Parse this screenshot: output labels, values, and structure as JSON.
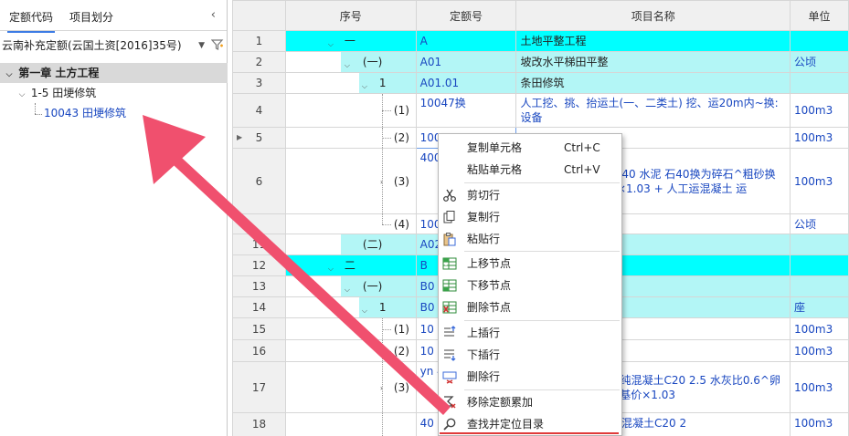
{
  "left_panel": {
    "tabs": [
      {
        "label": "定额代码"
      },
      {
        "label": "项目划分"
      }
    ],
    "collapse_glyph": "‹",
    "selector_value": "云南补充定额(云国土资[2016]35号)",
    "tree": {
      "chapter": "第一章 土方工程",
      "section": "1-5 田埂修筑",
      "item": "10043 田埂修筑"
    }
  },
  "grid": {
    "columns": [
      "序号",
      "定额号",
      "项目名称",
      "单位"
    ],
    "rows": [
      {
        "n": "1",
        "seq": "一",
        "code": "A",
        "name": "土地平整工程",
        "unit": ""
      },
      {
        "n": "2",
        "seq": "(一)",
        "code": "A01",
        "name": "坡改水平梯田平整",
        "unit": "公顷"
      },
      {
        "n": "3",
        "seq": "1",
        "code": "A01.01",
        "name": "条田修筑",
        "unit": ""
      },
      {
        "n": "4",
        "seq": "(1)",
        "code": "10047换",
        "name": "人工挖、挑、抬运土(一、二类土) 挖、运20m内~换:设备",
        "unit": "100m3"
      },
      {
        "n": "5",
        "seq": "(2)",
        "code": "100",
        "name": "",
        "unit": "100m3"
      },
      {
        "n": "6",
        "seq": "(3)",
        "code": "400 3+",
        "name": "凝土C20 2级配 粒径40 水泥 石40换为碎石^粗砂换为中砂 + 凝土 基价×1.03 + 人工运混凝土 运",
        "unit": "100m3"
      },
      {
        "n": "7",
        "seq": "(4)",
        "code": "100",
        "name": ")",
        "unit": "公顷"
      },
      {
        "n": "11",
        "seq": "(二)",
        "code": "A02",
        "name": "",
        "unit": ""
      },
      {
        "n": "12",
        "seq": "二",
        "code": "B",
        "name": "",
        "unit": ""
      },
      {
        "n": "13",
        "seq": "(一)",
        "code": "B0",
        "name": "",
        "unit": ""
      },
      {
        "n": "14",
        "seq": "1",
        "code": "B0",
        "name": "",
        "unit": "座"
      },
      {
        "n": "15",
        "seq": "(1)",
        "code": "10",
        "name": "土) 深度4m以内",
        "unit": "100m3"
      },
      {
        "n": "16",
        "seq": "(2)",
        "code": "10",
        "name": "方 一、二类土",
        "unit": "100m3"
      },
      {
        "n": "17",
        "seq": "(3)",
        "code": "yn 40",
        "name": "厚度15~25cm~换:纯混凝土C20 2.5 水灰比0.6^卵石40换为碎石 + 土 基价×1.03",
        "unit": "100m3"
      },
      {
        "n": "18",
        "seq": "",
        "code": "40",
        "name": "面积≤0.2m2~换:纯混凝土C20 2",
        "unit": "100m3"
      }
    ]
  },
  "context_menu": {
    "items": [
      {
        "label": "复制单元格",
        "shortcut": "Ctrl+C",
        "icon": "none"
      },
      {
        "label": "粘贴单元格",
        "shortcut": "Ctrl+V",
        "icon": "none"
      },
      {
        "label": "剪切行",
        "icon": "scissors-icon"
      },
      {
        "label": "复制行",
        "icon": "copy-icon"
      },
      {
        "label": "粘贴行",
        "icon": "paste-icon"
      },
      {
        "label": "上移节点",
        "icon": "move-up-node-icon"
      },
      {
        "label": "下移节点",
        "icon": "move-down-node-icon"
      },
      {
        "label": "删除节点",
        "icon": "delete-node-icon"
      },
      {
        "label": "上插行",
        "icon": "insert-above-icon"
      },
      {
        "label": "下插行",
        "icon": "insert-below-icon"
      },
      {
        "label": "删除行",
        "icon": "delete-row-icon"
      },
      {
        "label": "移除定额累加",
        "icon": "remove-accumulate-icon"
      },
      {
        "label": "查找并定位目录",
        "icon": "search-icon"
      }
    ]
  },
  "colors": {
    "level1": "#00ffff",
    "level2": "#b3f6f6",
    "link_text": "#1947c0",
    "annotation_arrow": "#f0506e",
    "highlight_underline": "#e03a3a"
  }
}
